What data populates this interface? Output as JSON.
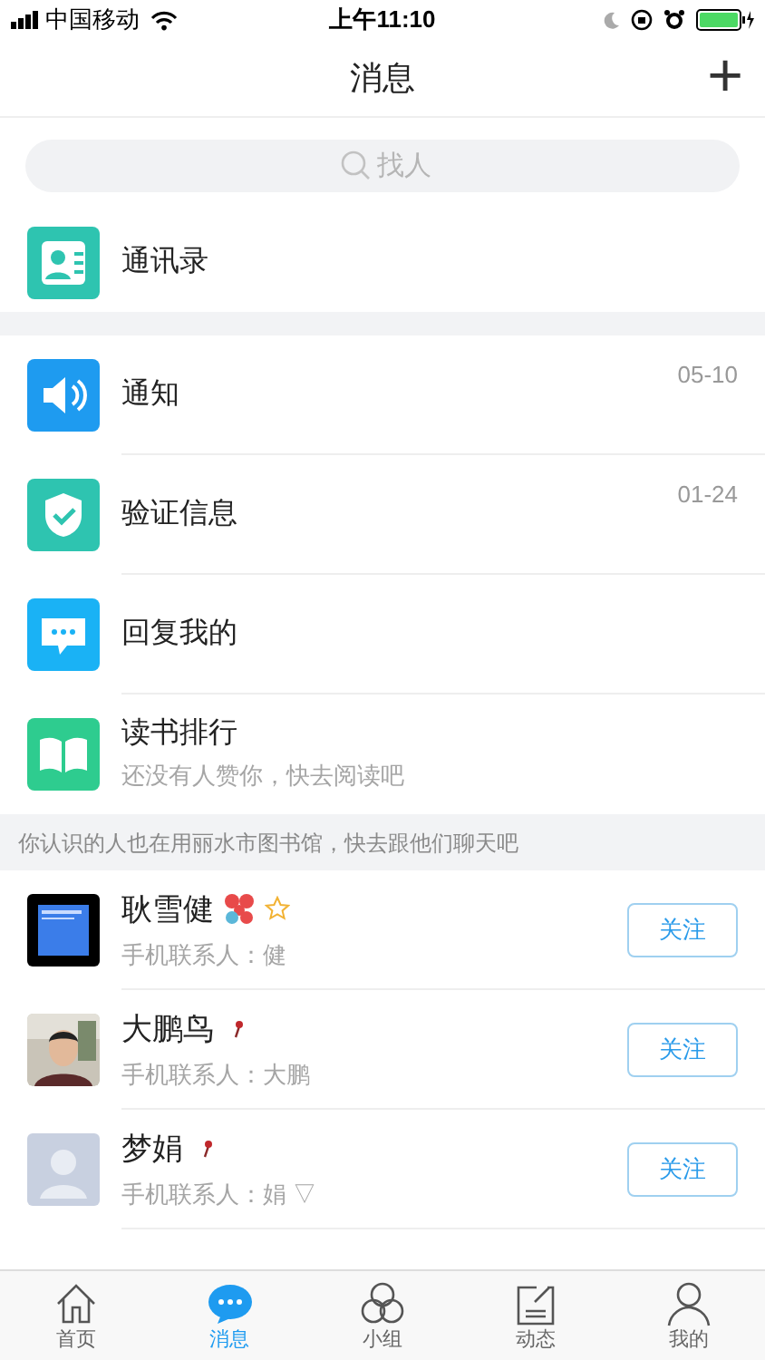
{
  "status_bar": {
    "carrier": "中国移动",
    "time": "上午11:10"
  },
  "nav": {
    "title": "消息",
    "add": "+"
  },
  "search": {
    "placeholder": "找人"
  },
  "contacts_entry": {
    "label": "通讯录"
  },
  "messages": [
    {
      "kind": "notice",
      "title": "通知",
      "date": "05-10"
    },
    {
      "kind": "verify",
      "title": "验证信息",
      "date": "01-24"
    },
    {
      "kind": "reply",
      "title": "回复我的"
    },
    {
      "kind": "reading",
      "title": "读书排行",
      "subtitle": "还没有人赞你，快去阅读吧"
    }
  ],
  "suggestion_banner": "你认识的人也在用丽水市图书馆，快去跟他们聊天吧",
  "people": [
    {
      "name": "耿雪健",
      "subtitle": "手机联系人：健",
      "kind": "screen",
      "badges": true,
      "button": "关注"
    },
    {
      "name": "大鹏鸟",
      "subtitle": "手机联系人：大鹏",
      "kind": "picture",
      "badges": false,
      "button": "关注"
    },
    {
      "name": "梦娟",
      "subtitle": "手机联系人：娟 ▽",
      "kind": "default",
      "badges": false,
      "button": "关注"
    }
  ],
  "tab_bar": [
    {
      "kind": "home",
      "label": "首页",
      "selected": false
    },
    {
      "kind": "chat",
      "label": "消息",
      "selected": true
    },
    {
      "kind": "group",
      "label": "小组",
      "selected": false
    },
    {
      "kind": "feed",
      "label": "动态",
      "selected": false
    },
    {
      "kind": "me",
      "label": "我的",
      "selected": false
    }
  ]
}
